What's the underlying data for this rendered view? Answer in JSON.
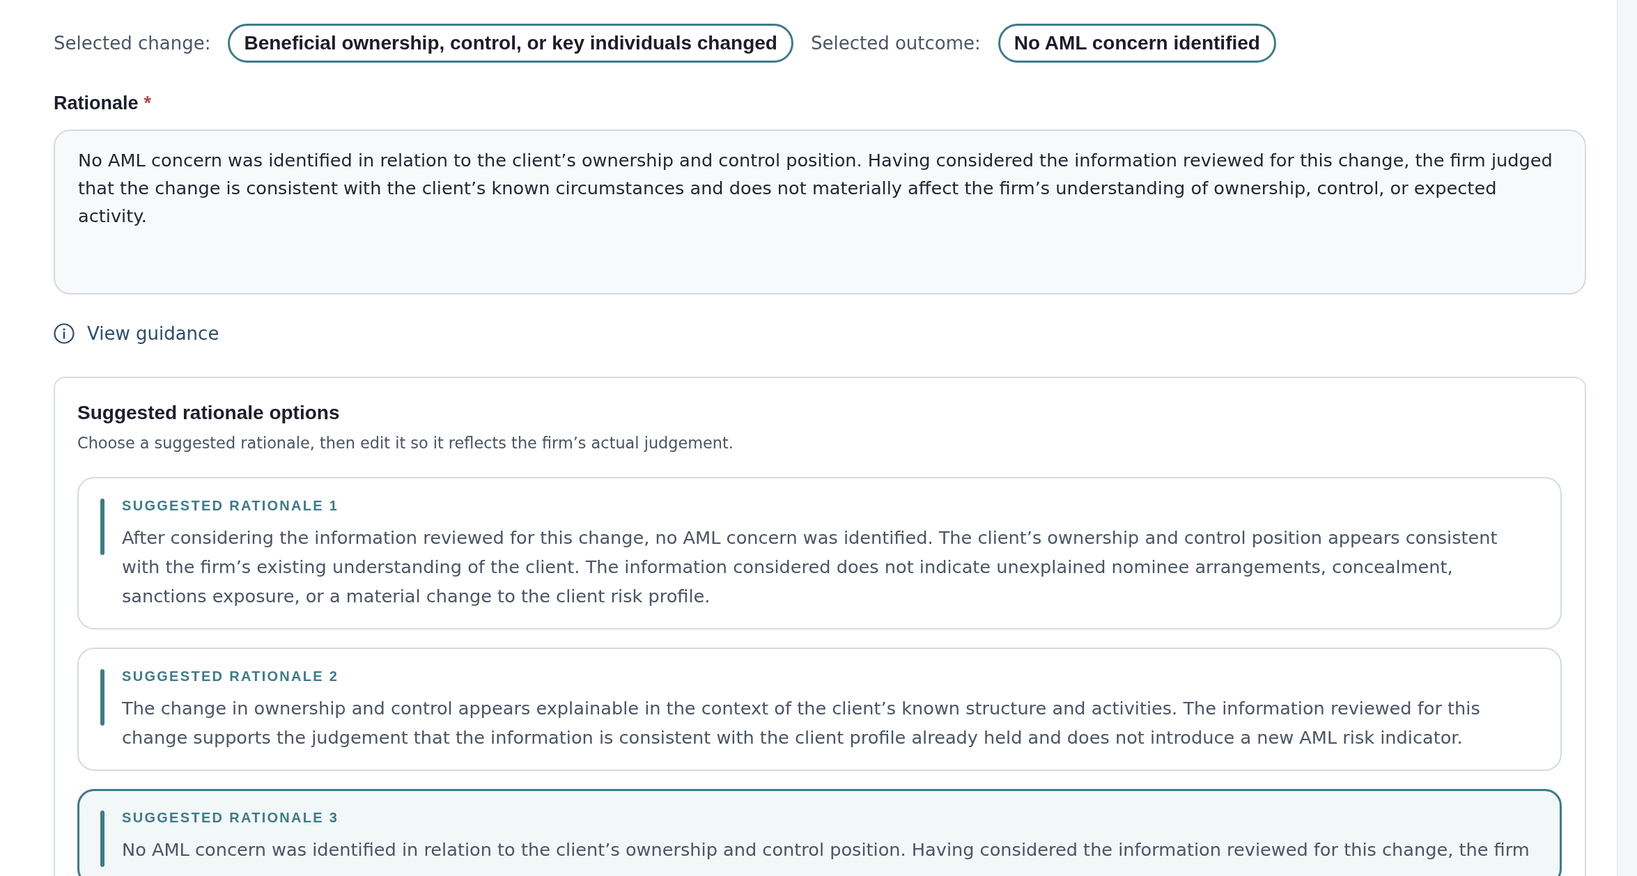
{
  "selection": [
    {
      "label": "Selected change:",
      "value": "Beneficial ownership, control, or key individuals changed"
    },
    {
      "label": "Selected outcome:",
      "value": "No AML concern identified"
    }
  ],
  "rationale": {
    "label": "Rationale",
    "required_mark": "*",
    "value": "No AML concern was identified in relation to the client’s ownership and control position. Having considered the information reviewed for this change, the firm judged that the change is consistent with the client’s known circumstances and does not materially affect the firm’s understanding of ownership, control, or expected activity."
  },
  "guidance_link": "View guidance",
  "suggestions": {
    "title": "Suggested rationale options",
    "subtitle": "Choose a suggested rationale, then edit it so it reflects the firm’s actual judgement.",
    "options": [
      {
        "label": "SUGGESTED RATIONALE 1",
        "text": "After considering the information reviewed for this change, no AML concern was identified. The client’s ownership and control position appears consistent with the firm’s existing understanding of the client. The information considered does not indicate unexplained nominee arrangements, concealment, sanctions exposure, or a material change to the client risk profile.",
        "selected": false
      },
      {
        "label": "SUGGESTED RATIONALE 2",
        "text": "The change in ownership and control appears explainable in the context of the client’s known structure and activities. The information reviewed for this change supports the judgement that the information is consistent with the client profile already held and does not introduce a new AML risk indicator.",
        "selected": false
      },
      {
        "label": "SUGGESTED RATIONALE 3",
        "text": "No AML concern was identified in relation to the client’s ownership and control position. Having considered the information reviewed for this change, the firm",
        "selected": true
      }
    ]
  }
}
